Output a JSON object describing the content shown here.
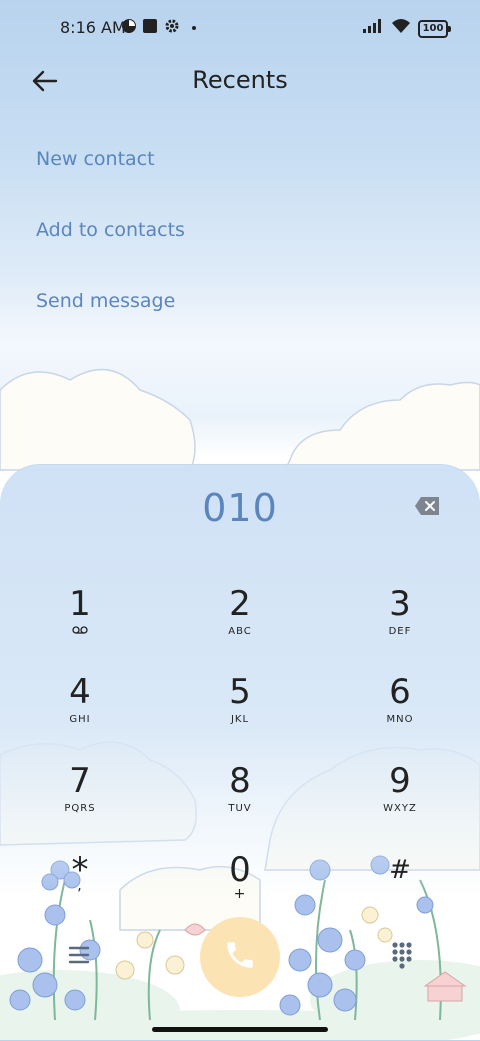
{
  "status_bar": {
    "time": "8:16 AM",
    "battery": "100",
    "icons": [
      "app-notification-icon",
      "square-notification-icon",
      "gear-icon",
      "dot-icon",
      "signal-icon",
      "wifi-icon",
      "battery-icon"
    ]
  },
  "header": {
    "title": "Recents",
    "back_icon": "back-arrow-icon"
  },
  "actions": [
    {
      "label": "New contact"
    },
    {
      "label": "Add to contacts"
    },
    {
      "label": "Send message"
    }
  ],
  "dialer": {
    "number": "010",
    "backspace_icon": "backspace-icon",
    "keys": [
      {
        "digit": "1",
        "letters": ""
      },
      {
        "digit": "2",
        "letters": "ABC"
      },
      {
        "digit": "3",
        "letters": "DEF"
      },
      {
        "digit": "4",
        "letters": "GHI"
      },
      {
        "digit": "5",
        "letters": "JKL"
      },
      {
        "digit": "6",
        "letters": "MNO"
      },
      {
        "digit": "7",
        "letters": "PQRS"
      },
      {
        "digit": "8",
        "letters": "TUV"
      },
      {
        "digit": "9",
        "letters": "WXYZ"
      },
      {
        "digit": "*",
        "letters": ","
      },
      {
        "digit": "0",
        "letters": "+"
      },
      {
        "digit": "#",
        "letters": ""
      }
    ],
    "bottom": {
      "menu_icon": "menu-icon",
      "call_icon": "phone-icon",
      "keypad_icon": "dialpad-icon"
    }
  },
  "colors": {
    "accent": "#5a86bd",
    "call_button": "#fbe3b4",
    "panel": "#d2e3f5"
  }
}
